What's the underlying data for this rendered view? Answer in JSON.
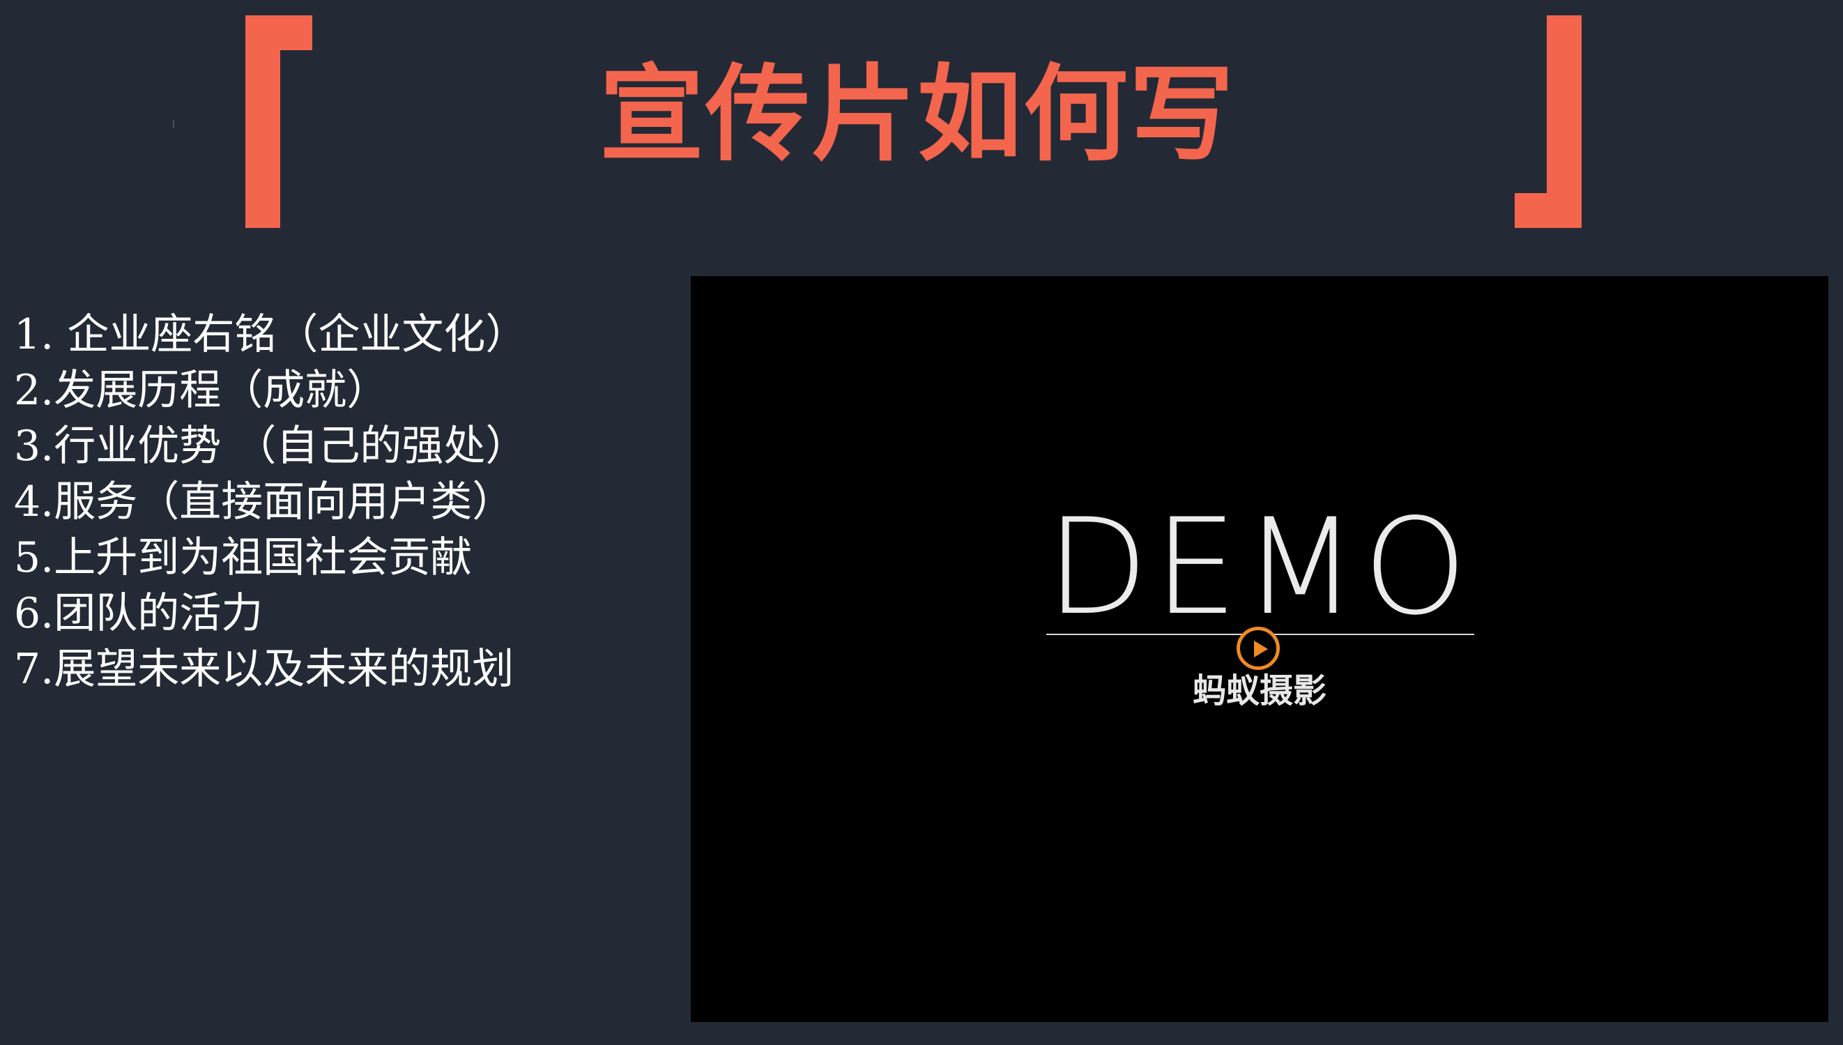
{
  "slide": {
    "title": "宣传片如何写",
    "accent_color": "#f4654d",
    "background_color": "#232a35"
  },
  "list": {
    "items": [
      "1. 企业座右铭（企业文化）",
      "2.发展历程（成就）",
      "3.行业优势 （自己的强处）",
      "4.服务（直接面向用户类）",
      "5.上升到为祖国社会贡献",
      "6.团队的活力",
      "7.展望未来以及未来的规划"
    ]
  },
  "video": {
    "demo_text": "DEMO",
    "brand_text": "蚂蚁摄影",
    "play_icon": "play-icon",
    "play_color": "#f08a23"
  }
}
